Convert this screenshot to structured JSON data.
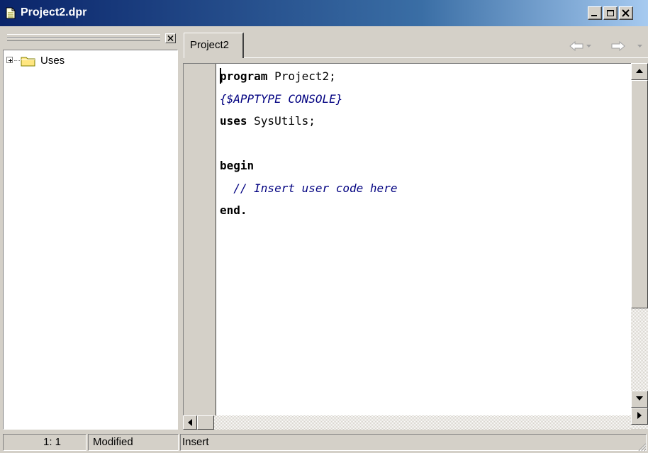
{
  "window": {
    "title": "Project2.dpr",
    "icon": "document-icon"
  },
  "tree": {
    "items": [
      {
        "label": "Uses",
        "icon": "folder-icon",
        "expander": "plus"
      }
    ]
  },
  "tabs": [
    {
      "label": "Project2",
      "active": true
    }
  ],
  "editor": {
    "lines": [
      {
        "parts": [
          {
            "text": "program",
            "style": "kw"
          },
          {
            "text": " Project2;",
            "style": "plain"
          }
        ]
      },
      {
        "parts": [
          {
            "text": "{$APPTYPE CONSOLE}",
            "style": "dir"
          }
        ]
      },
      {
        "parts": [
          {
            "text": "uses",
            "style": "kw"
          },
          {
            "text": " SysUtils;",
            "style": "plain"
          }
        ]
      },
      {
        "parts": [
          {
            "text": "",
            "style": "plain"
          }
        ]
      },
      {
        "parts": [
          {
            "text": "begin",
            "style": "kw"
          }
        ]
      },
      {
        "parts": [
          {
            "text": "  // Insert user code here",
            "style": "cmt"
          }
        ]
      },
      {
        "parts": [
          {
            "text": "end.",
            "style": "kw"
          }
        ]
      }
    ]
  },
  "statusbar": {
    "position": "1:   1",
    "modified": "Modified",
    "mode": "Insert"
  },
  "colors": {
    "titlebar_start": "#0a246a",
    "titlebar_end": "#a6caf0",
    "face": "#d4d0c8",
    "code_blue": "#000080"
  }
}
